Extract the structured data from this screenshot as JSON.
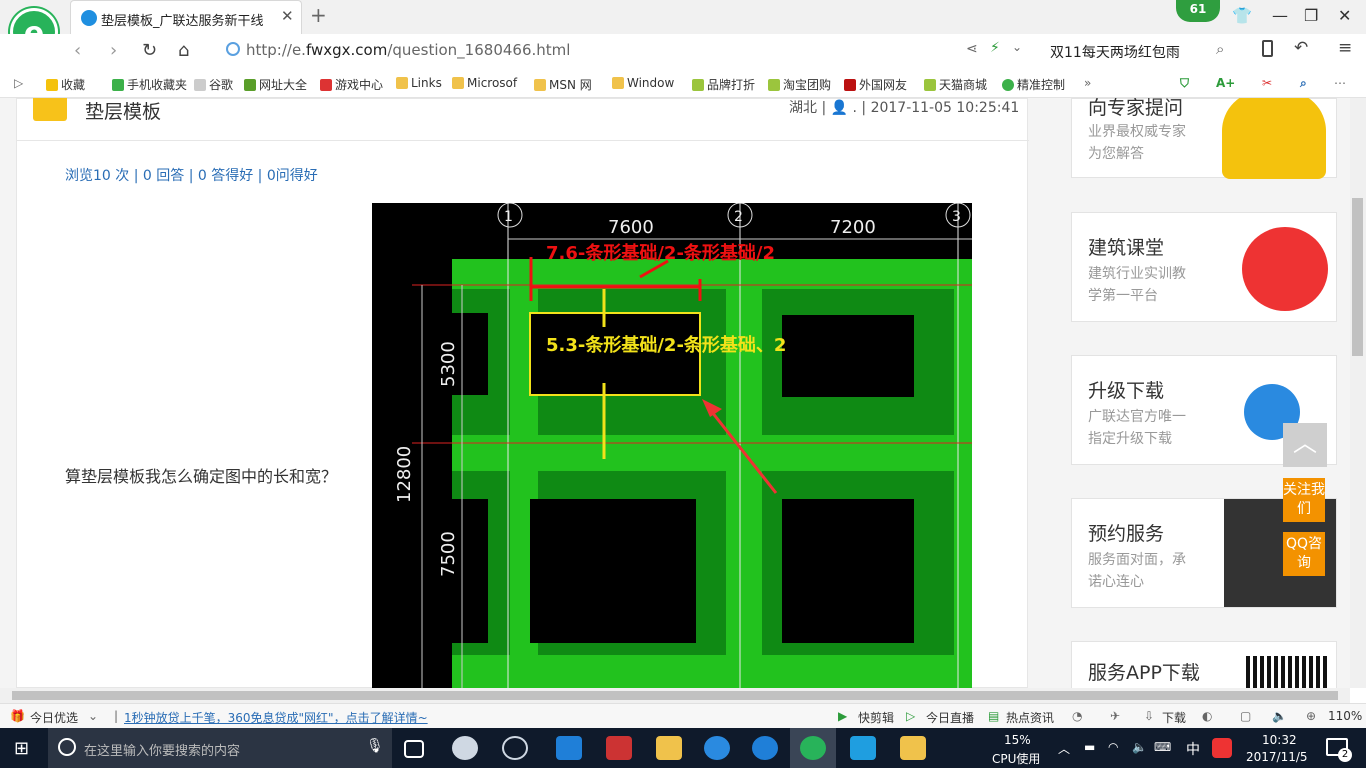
{
  "browser": {
    "tab_title": "垫层模板_广联达服务新干线",
    "url_prefix": "http://e.",
    "url_domain": "fwxgx.com",
    "url_path": "/question_1680466.html",
    "promo_text": "双11每天两场红包雨",
    "badge_count": "61"
  },
  "bookmarks": [
    "收藏",
    "手机收藏夹",
    "谷歌",
    "网址大全",
    "游戏中心",
    "Links",
    "Microsof",
    "MSN 网",
    "Window",
    "品牌打折",
    "淘宝团购",
    "外国网友",
    "天猫商城",
    "精准控制"
  ],
  "question": {
    "title": "垫层模板",
    "meta": "湖北 | 👤 . | 2017-11-05 10:25:41",
    "stats": "浏览10 次 | 0 回答 | 0 答得好 | 0问得好",
    "text": "算垫层模板我怎么确定图中的长和宽？"
  },
  "cad": {
    "axis_labels": [
      "1",
      "2",
      "3"
    ],
    "dims_top": [
      "7600",
      "7200"
    ],
    "dim_left_outer": "12800",
    "dims_left": [
      "5300",
      "7500"
    ],
    "red_annotation": "7.6-条形基础/2-条形基础/2",
    "yellow_annotation": "5.3-条形基础/2-条形基础、2"
  },
  "sidebar": [
    {
      "title": "向专家提问",
      "desc": [
        "业界最权威专家",
        "为您解答"
      ]
    },
    {
      "title": "建筑课堂",
      "desc": [
        "建筑行业实训教",
        "学第一平台"
      ]
    },
    {
      "title": "升级下载",
      "desc": [
        "广联达官方唯一",
        "指定升级下载"
      ]
    },
    {
      "title": "预约服务",
      "desc": [
        "服务面对面，承",
        "诺心连心"
      ]
    },
    {
      "title": "服务APP下载",
      "desc": []
    }
  ],
  "float_buttons": {
    "follow": "关注我们",
    "qq": "QQ咨询"
  },
  "statusbar": {
    "left": "今日优选",
    "news": "1秒钟放贷上千笔，360免息贷成\"网红\"，点击了解详情~",
    "items": [
      "快剪辑",
      "今日直播",
      "热点资讯",
      "下载"
    ],
    "zoom": "110%"
  },
  "taskbar": {
    "search_placeholder": "在这里输入你要搜索的内容",
    "cpu_percent": "15%",
    "cpu_label": "CPU使用",
    "ime": "中",
    "time": "10:32",
    "date": "2017/11/5",
    "notif_count": "2"
  }
}
